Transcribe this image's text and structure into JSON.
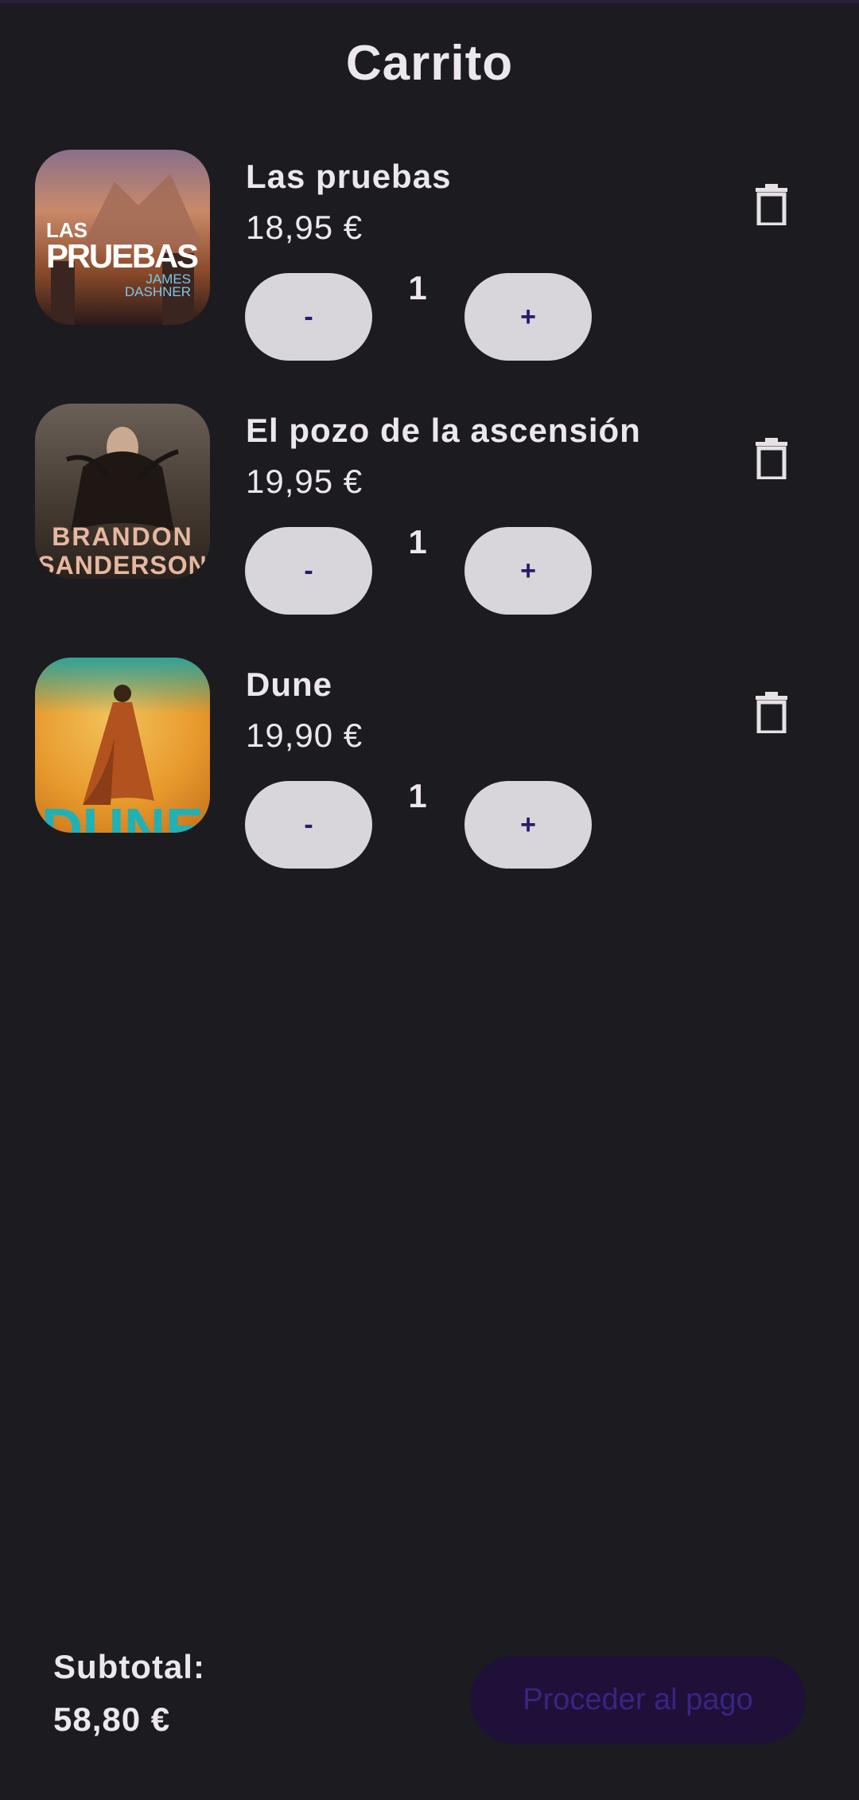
{
  "header": {
    "title": "Carrito"
  },
  "cart": {
    "items": [
      {
        "title": "Las pruebas",
        "price": "18,95 €",
        "quantity": "1",
        "minus_label": "-",
        "plus_label": "+",
        "cover_icon": "book-cover-las-pruebas",
        "cover_text": [
          "LAS",
          "PRUEBAS",
          "JAMES",
          "DASHNER"
        ]
      },
      {
        "title": "El pozo de la ascensión",
        "price": "19,95 €",
        "quantity": "1",
        "minus_label": "-",
        "plus_label": "+",
        "cover_icon": "book-cover-el-pozo",
        "cover_text": [
          "BRANDON",
          "SANDERSON"
        ]
      },
      {
        "title": "Dune",
        "price": "19,90 €",
        "quantity": "1",
        "minus_label": "-",
        "plus_label": "+",
        "cover_icon": "book-cover-dune",
        "cover_text": [
          "DUNE"
        ]
      }
    ],
    "delete_icon": "trash-icon"
  },
  "footer": {
    "subtotal_label": "Subtotal:",
    "subtotal_value": "58,80 €",
    "checkout_label": "Proceder al pago"
  },
  "colors": {
    "background": "#1c1b20",
    "button_bg": "#d8d6da",
    "button_text": "#2c1a6b",
    "checkout_bg": "#1e1038",
    "checkout_text": "#3a2480"
  }
}
